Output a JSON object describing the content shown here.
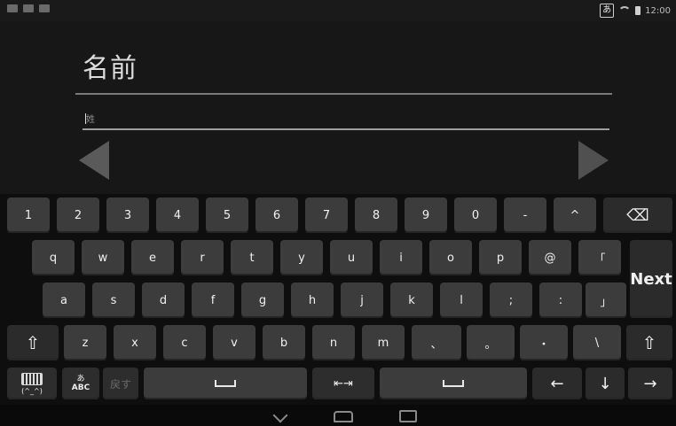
{
  "status_bar": {
    "ime_indicator": "あ",
    "time": "12:00"
  },
  "form": {
    "title": "名前",
    "field_placeholder": "姓"
  },
  "keyboard": {
    "row1": [
      "1",
      "2",
      "3",
      "4",
      "5",
      "6",
      "7",
      "8",
      "9",
      "0",
      "-",
      "^"
    ],
    "row2": [
      "q",
      "w",
      "e",
      "r",
      "t",
      "y",
      "u",
      "i",
      "o",
      "p",
      "@",
      "「"
    ],
    "row3": [
      "a",
      "s",
      "d",
      "f",
      "g",
      "h",
      "j",
      "k",
      "l",
      ";",
      ":",
      "」"
    ],
    "row4": [
      "z",
      "x",
      "c",
      "v",
      "b",
      "n",
      "m",
      "、",
      "。",
      "・",
      "\\"
    ],
    "next_label": "Next",
    "backspace_symbol": "⌫",
    "shift_symbol": "⇧",
    "mode_switch_top": "あ",
    "mode_switch_bottom": "ABC",
    "undo_label": "戻す",
    "emoji_label": "(^_^)",
    "cursor_toggle_label": "⇤⇥",
    "arrow_left": "←",
    "arrow_down": "↓",
    "arrow_right": "→"
  },
  "colors": {
    "background": "#0f0f0f",
    "key": "#3c3c3c",
    "key_dark": "#2d2d2d",
    "text": "#f0f0f0"
  }
}
